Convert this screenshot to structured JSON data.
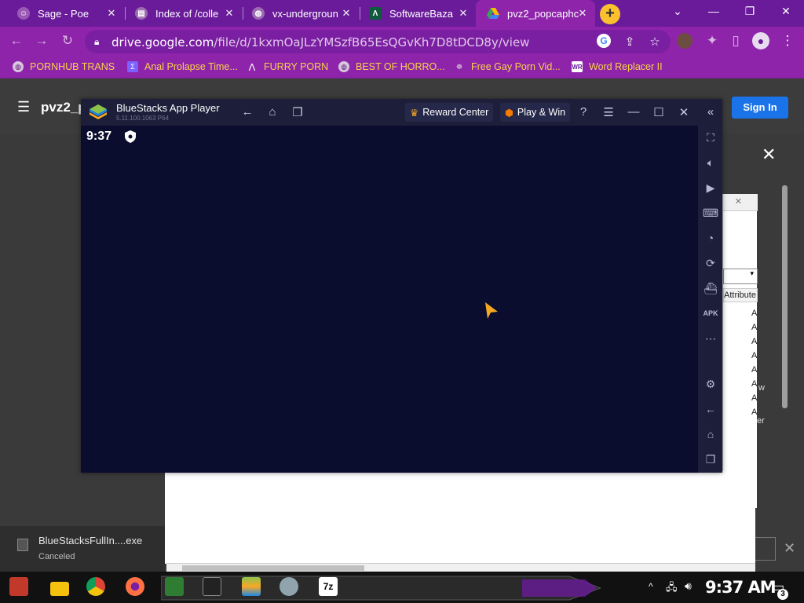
{
  "browser": {
    "tabs": [
      {
        "label": "Sage - Poe",
        "icon": "poe-icon",
        "color": "#9b59b6"
      },
      {
        "label": "Index of /colle",
        "icon": "file-index-icon",
        "color": "#9c6cb1"
      },
      {
        "label": "vx-undergroun",
        "icon": "globe-icon",
        "color": "#9c6cb1"
      },
      {
        "label": "SoftwareBaza",
        "icon": "softwarebazar-icon",
        "color": "#0f5a3c"
      },
      {
        "label": "pvz2_popcaphc",
        "icon": "google-drive-icon",
        "color": "#1e88e5"
      }
    ],
    "new_tab_label": "+",
    "window_controls": {
      "dropdown": "⌄",
      "minimize": "—",
      "restore": "❐",
      "close": "✕"
    },
    "url_domain": "drive.google.com",
    "url_path": "/file/d/1kxmOaJLzYMSzfB65EsQGvKh7D8tDCD8y/view",
    "bookmarks": [
      {
        "label": "PORNHUB TRANS",
        "icon": "globe-icon"
      },
      {
        "label": "Anal Prolapse Time...",
        "icon": "bookmark-icon"
      },
      {
        "label": "FURRY PORN",
        "icon": "arrow-icon"
      },
      {
        "label": "BEST OF HORRO...",
        "icon": "globe-icon"
      },
      {
        "label": "Free Gay Porn Vid...",
        "icon": "bookmark-icon"
      },
      {
        "label": "Word Replacer II",
        "icon": "wr-icon"
      }
    ]
  },
  "drive": {
    "title": "pvz2_p",
    "sign_in": "Sign In",
    "close": "✕",
    "panel_column": "Attribute",
    "panel_rows": [
      "A",
      "A",
      "A",
      "A",
      "A",
      "A",
      "A",
      "A"
    ],
    "edge_letters": [
      "w",
      "er"
    ]
  },
  "bluestacks": {
    "app_name": "BlueStacks App Player",
    "version": "5.11.100.1063  P64",
    "reward_center": "Reward Center",
    "play_win": "Play & Win",
    "clock": "9:37",
    "accent": "#f5a623"
  },
  "download": {
    "filename": "BlueStacksFullIn....exe",
    "status": "Canceled"
  },
  "taskbar": {
    "time": "9:37 AM",
    "notifications": "3"
  }
}
